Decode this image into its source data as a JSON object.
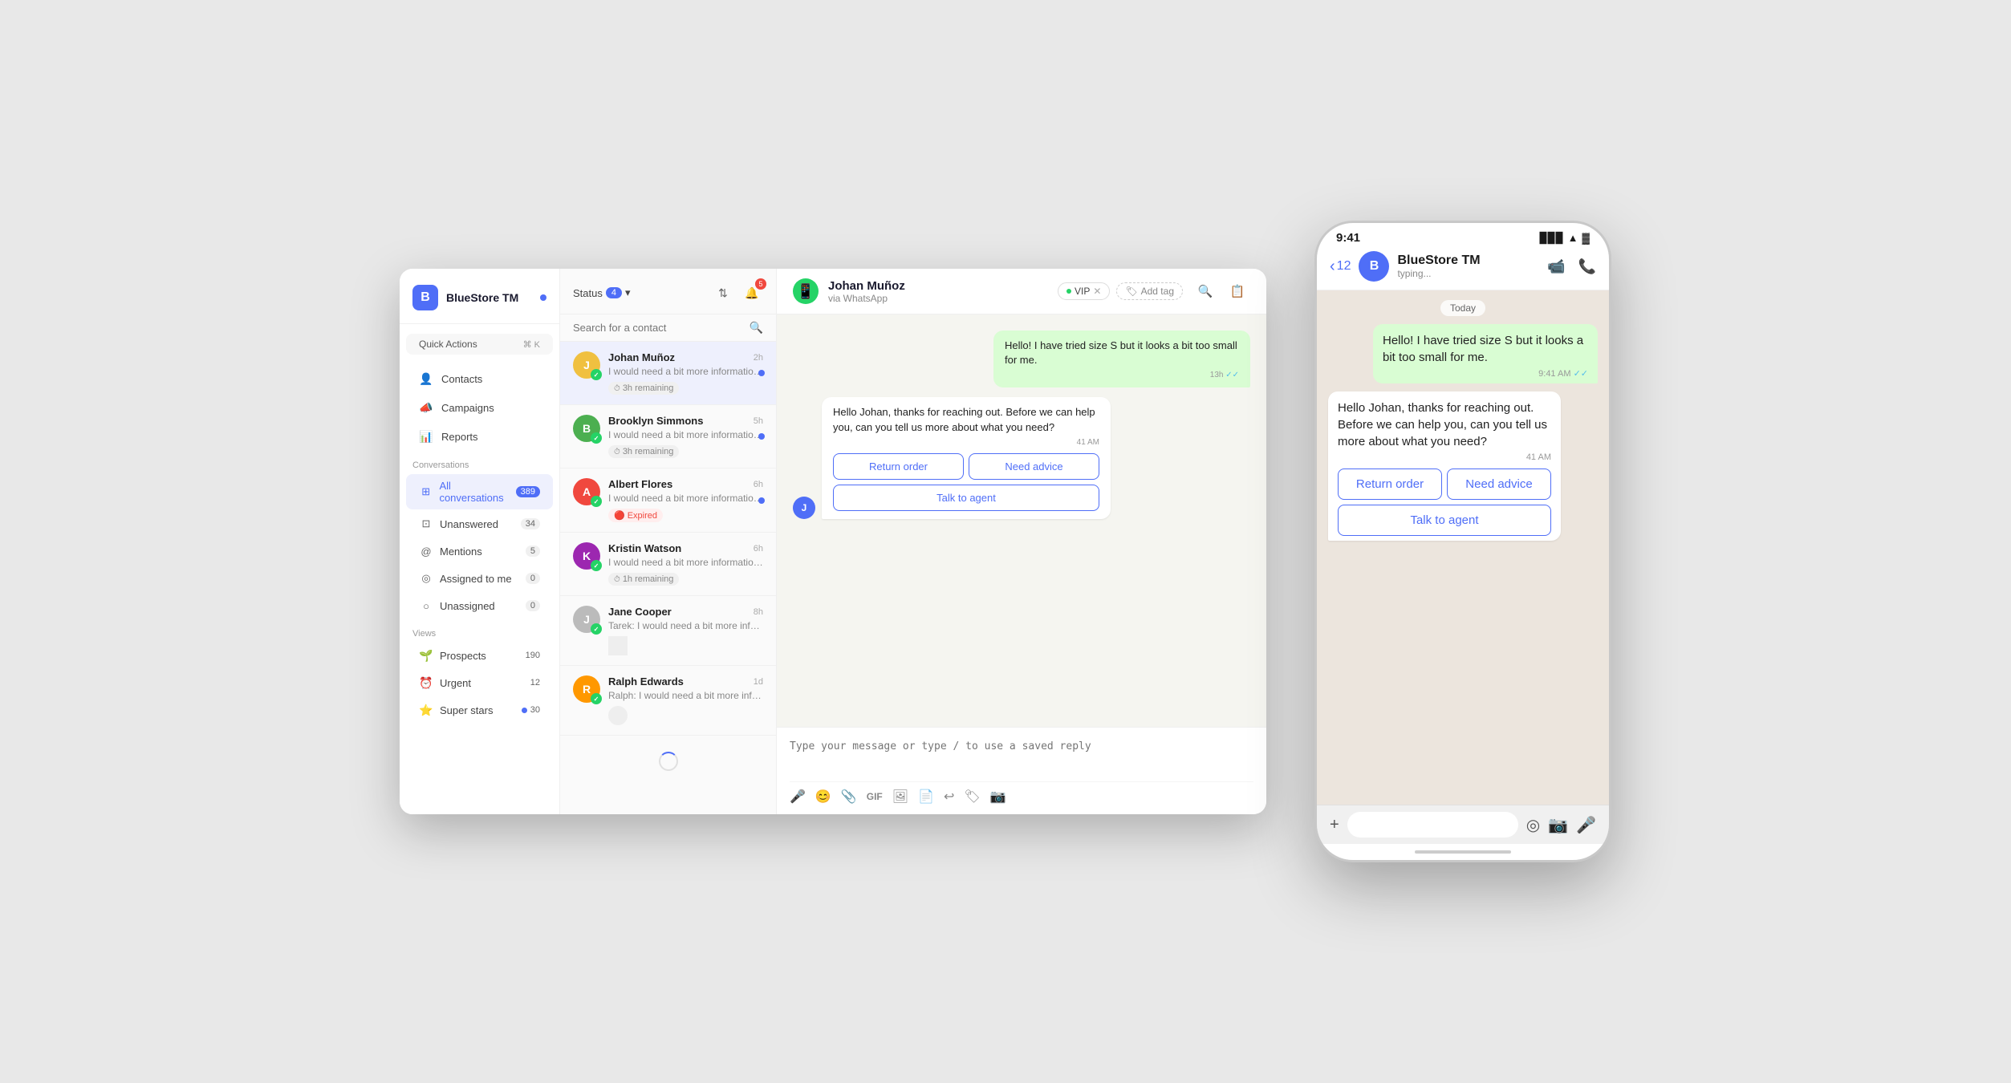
{
  "app": {
    "brand_name": "BlueStore TM",
    "brand_dot_color": "#4f6ef7"
  },
  "sidebar": {
    "quick_actions_label": "Quick Actions",
    "quick_actions_shortcut": "⌘ K",
    "nav_items": [
      {
        "label": "Contacts",
        "icon": "👤"
      },
      {
        "label": "Campaigns",
        "icon": "📣"
      },
      {
        "label": "Reports",
        "icon": "📊"
      }
    ],
    "conversations_section": "Conversations",
    "conv_items": [
      {
        "label": "All conversations",
        "badge": "389",
        "active": true
      },
      {
        "label": "Unanswered",
        "badge": "34"
      },
      {
        "label": "Mentions",
        "badge": "5"
      },
      {
        "label": "Assigned to me",
        "badge": "0"
      },
      {
        "label": "Unassigned",
        "badge": "0"
      }
    ],
    "views_section": "Views",
    "view_items": [
      {
        "label": "Prospects",
        "badge": "190",
        "icon": "🌱"
      },
      {
        "label": "Urgent",
        "badge": "12",
        "icon": "⏰"
      },
      {
        "label": "Super stars",
        "badge": "30",
        "dot": true,
        "icon": "⭐"
      }
    ]
  },
  "conv_list": {
    "status_label": "Status",
    "status_count": "4",
    "bell_count": "5",
    "search_placeholder": "Search for a contact",
    "entries": [
      {
        "name": "Johan Muñoz",
        "msg": "I would need a bit more information if that's...",
        "time": "2h",
        "timer": "3h remaining",
        "has_unread": true,
        "avatar_bg": "#f0c040",
        "avatar_letter": "J",
        "selected": true
      },
      {
        "name": "Brooklyn Simmons",
        "msg": "I would need a bit more information if that's...",
        "time": "5h",
        "timer": "3h remaining",
        "has_unread": true,
        "avatar_bg": "#4caf50",
        "avatar_letter": "B"
      },
      {
        "name": "Albert Flores",
        "msg": "I would need a bit more information if that's...",
        "time": "6h",
        "expired": true,
        "has_unread": true,
        "avatar_bg": "#f0483e",
        "avatar_letter": "A"
      },
      {
        "name": "Kristin Watson",
        "msg": "I would need a bit more information if that's...",
        "time": "6h",
        "timer": "1h remaining",
        "has_unread": false,
        "avatar_bg": "#9c27b0",
        "avatar_letter": "K"
      },
      {
        "name": "Jane Cooper",
        "msg": "Tarek: I would need a bit more information...",
        "time": "8h",
        "has_unread": false,
        "avatar_bg": "#aaa",
        "avatar_letter": "J"
      },
      {
        "name": "Ralph Edwards",
        "msg": "Ralph: I would need a bit more information...",
        "time": "1d",
        "has_unread": false,
        "avatar_bg": "#ff9800",
        "avatar_letter": "R"
      }
    ]
  },
  "chat": {
    "contact_name": "Johan Muñoz",
    "contact_sub": "via WhatsApp",
    "vip_label": "VIP",
    "add_tag_label": "Add tag",
    "messages": [
      {
        "type": "out",
        "text": "Hello! I have tried size S but it looks a bit too small for me.",
        "time": "13h",
        "check": "✓✓"
      },
      {
        "type": "in",
        "text": "Hello Johan, thanks for reaching out. Before we can help you, can you tell us more about what you need?",
        "time": "41 AM",
        "has_actions": true,
        "actions": [
          {
            "label": "Return order"
          },
          {
            "label": "Need advice"
          }
        ],
        "action_full": "Talk to agent"
      }
    ],
    "input_placeholder": "Type your message or type / to use a saved reply"
  },
  "phone": {
    "time": "9:41",
    "back_count": "12",
    "brand_name": "BlueStore TM",
    "status": "typing...",
    "messages": [
      {
        "type": "out",
        "text": "Hello! I have tried size S but it looks a bit too small for me.",
        "time": "9:41 AM",
        "check": "✓✓"
      },
      {
        "type": "in",
        "text": "Hello Johan, thanks for reaching out. Before we can help you, can you tell us more about what you need?",
        "time": "41 AM",
        "has_actions": true,
        "btn1": "Return order",
        "btn2": "Need advice",
        "btn_full": "Talk to agent"
      }
    ],
    "date_label": "Today"
  }
}
